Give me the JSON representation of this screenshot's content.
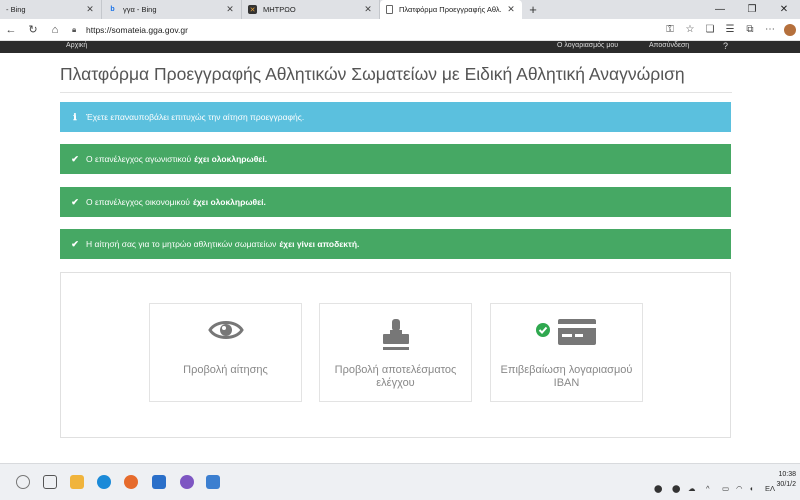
{
  "browser": {
    "tabs": [
      {
        "title": "- Bing",
        "icon": "bing-icon",
        "active": false
      },
      {
        "title": "γγα - Bing",
        "icon": "bing-icon",
        "active": false
      },
      {
        "title": "ΜΗΤΡΩΟ",
        "icon": "mitroo-icon",
        "active": false
      },
      {
        "title": "Πλατφόρμα Προεγγραφής Αθλ.",
        "icon": "page-icon",
        "active": true
      }
    ],
    "new_tab": "+",
    "url": "https://somateia.gga.gov.gr",
    "window_controls": {
      "minimize": "—",
      "maximize": "❐",
      "close": "✕"
    }
  },
  "site_nav": {
    "home": "Αρχική",
    "right_1": "Ο λογαριασμός μου",
    "right_2": "Αποσύνδεση",
    "right_3": "?"
  },
  "page": {
    "title": "Πλατφόρμα Προεγγραφής Αθλητικών Σωματείων με Ειδική Αθλητική Αναγνώριση",
    "alerts": {
      "info": {
        "text": "Έχετε επαναυποβάλει επιτυχώς την αίτηση προεγγραφής."
      },
      "success_1": {
        "pre": "Ο επανέλεγχος αγωνιστικού",
        "bold": "έχει ολοκληρωθεί."
      },
      "success_2": {
        "pre": "Ο επανέλεγχος οικονομικού",
        "bold": "έχει ολοκληρωθεί."
      },
      "success_3": {
        "pre": "Η αίτησή σας για το μητρώο αθλητικών σωματείων",
        "bold": "έχει γίνει αποδεκτή."
      }
    },
    "cards": [
      {
        "label": "Προβολή αίτησης",
        "icon": "eye-icon"
      },
      {
        "label": "Προβολή αποτελέσματος ελέγχου",
        "icon": "stamp-icon"
      },
      {
        "label": "Επιβεβαίωση λογαριασμού IBAN",
        "icon": "credit-card-check-icon"
      }
    ]
  },
  "taskbar": {
    "language": "ΕΛ",
    "time": "10:38",
    "date": "30/1/2"
  },
  "colors": {
    "info": "#5bc0de",
    "success": "#46a864",
    "icon_gray": "#777777",
    "check_green": "#2fa84f"
  }
}
